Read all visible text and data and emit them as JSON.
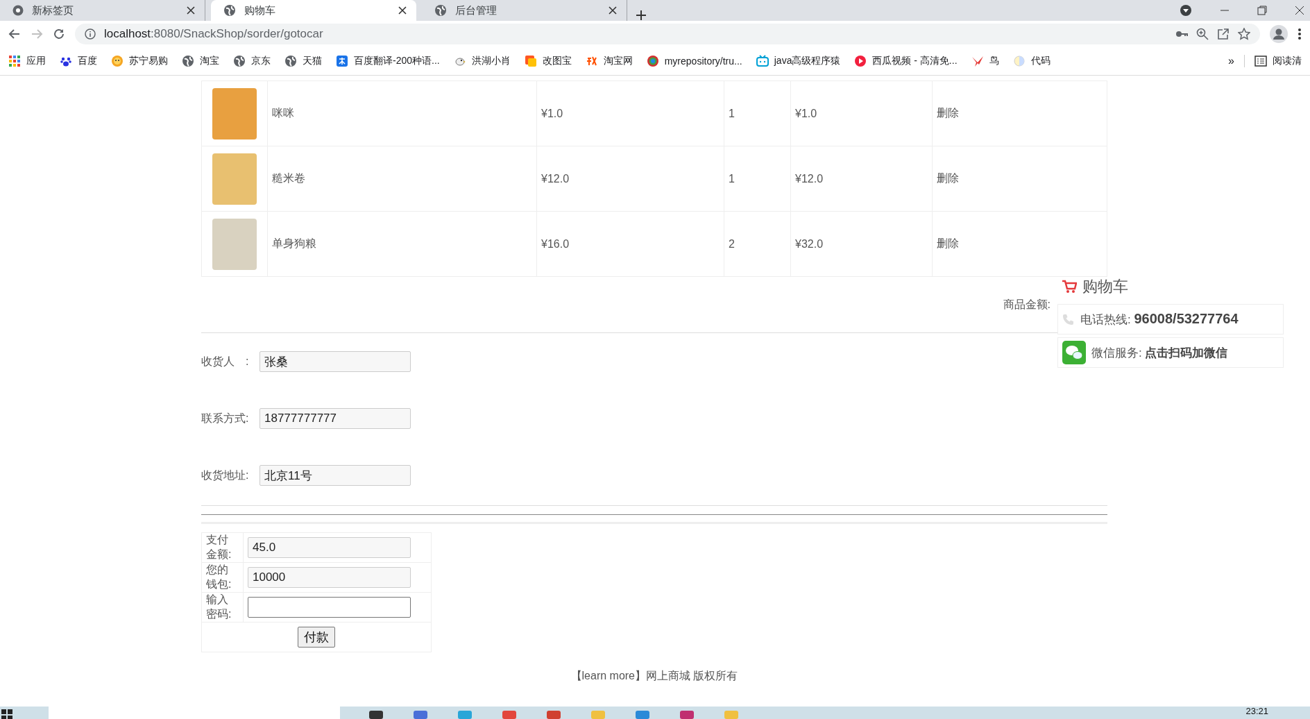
{
  "browser": {
    "tabs": [
      {
        "title": "新标签页",
        "selected": false
      },
      {
        "title": "购物车",
        "selected": true
      },
      {
        "title": "后台管理",
        "selected": false
      }
    ],
    "url_host": "localhost",
    "url_path": ":8080/SnackShop/sorder/gotocar",
    "bookmarks": [
      {
        "label": "应用",
        "kind": "apps"
      },
      {
        "label": "百度",
        "kind": "paw"
      },
      {
        "label": "苏宁易购",
        "kind": "lion"
      },
      {
        "label": "淘宝",
        "kind": "globe"
      },
      {
        "label": "京东",
        "kind": "globe"
      },
      {
        "label": "天猫",
        "kind": "globe"
      },
      {
        "label": "百度翻译-200种语...",
        "kind": "translate"
      },
      {
        "label": "洪湖小肖",
        "kind": "bird"
      },
      {
        "label": "改图宝",
        "kind": "square"
      },
      {
        "label": "淘宝网",
        "kind": "tao"
      },
      {
        "label": "myrepository/tru...",
        "kind": "ring"
      },
      {
        "label": "java高级程序猿",
        "kind": "tv"
      },
      {
        "label": "西瓜视频 - 高清免...",
        "kind": "play"
      },
      {
        "label": "鸟",
        "kind": "swallow"
      },
      {
        "label": "代码",
        "kind": "half"
      }
    ],
    "overflow": "»",
    "reading_list": "阅读清"
  },
  "cart": {
    "rows": [
      {
        "name": "咪咪",
        "price": "¥1.0",
        "qty": "1",
        "subtotal": "¥1.0",
        "action": "删除"
      },
      {
        "name": "糙米卷",
        "price": "¥12.0",
        "qty": "1",
        "subtotal": "¥12.0",
        "action": "删除"
      },
      {
        "name": "单身狗粮",
        "price": "¥16.0",
        "qty": "2",
        "subtotal": "¥32.0",
        "action": "删除"
      }
    ],
    "total_label": "商品金额:"
  },
  "side_panel": {
    "title": "购物车",
    "phone_label": "电话热线:",
    "phone": "96008/53277764",
    "wechat_label": "微信服务:",
    "wechat": "点击扫码加微信"
  },
  "delivery": [
    {
      "label": "收货人　:",
      "value": "张桑"
    },
    {
      "label": "联系方式:",
      "value": "18777777777"
    },
    {
      "label": "收货地址:",
      "value": "北京11号"
    }
  ],
  "payment": {
    "rows": [
      {
        "label": "支付金额:",
        "value": "45.0",
        "kind": "readonly"
      },
      {
        "label": "您的钱包:",
        "value": "10000",
        "kind": "readonly"
      },
      {
        "label": "输入密码:",
        "kind": "password"
      }
    ],
    "button": "付款"
  },
  "footer": "【learn more】网上商城 版权所有",
  "taskbar": {
    "time": "23:21"
  }
}
